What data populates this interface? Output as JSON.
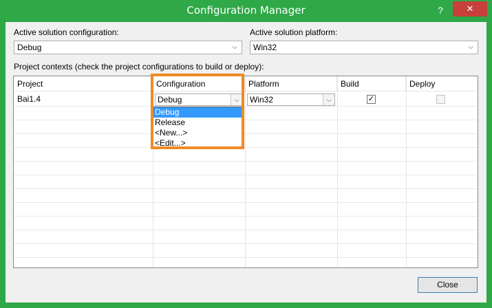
{
  "window": {
    "title": "Configuration Manager",
    "help_icon": "?",
    "close_icon": "✕"
  },
  "active_config": {
    "label": "Active solution configuration:",
    "value": "Debug"
  },
  "active_platform": {
    "label": "Active solution platform:",
    "value": "Win32"
  },
  "project_contexts": {
    "label": "Project contexts (check the project configurations to build or deploy):"
  },
  "table": {
    "columns": [
      "Project",
      "Configuration",
      "Platform",
      "Build",
      "Deploy"
    ],
    "rows": [
      {
        "project": "Bai1.4",
        "configuration": "Debug",
        "platform": "Win32",
        "build": true,
        "deploy": false
      }
    ]
  },
  "config_dropdown": {
    "options": [
      "Debug",
      "Release",
      "<New...>",
      "<Edit...>"
    ],
    "selected": "Debug"
  },
  "buttons": {
    "close": "Close"
  },
  "colors": {
    "title_bar": "#2fa848",
    "highlight_border": "#f08a24",
    "selection": "#3399ff"
  }
}
